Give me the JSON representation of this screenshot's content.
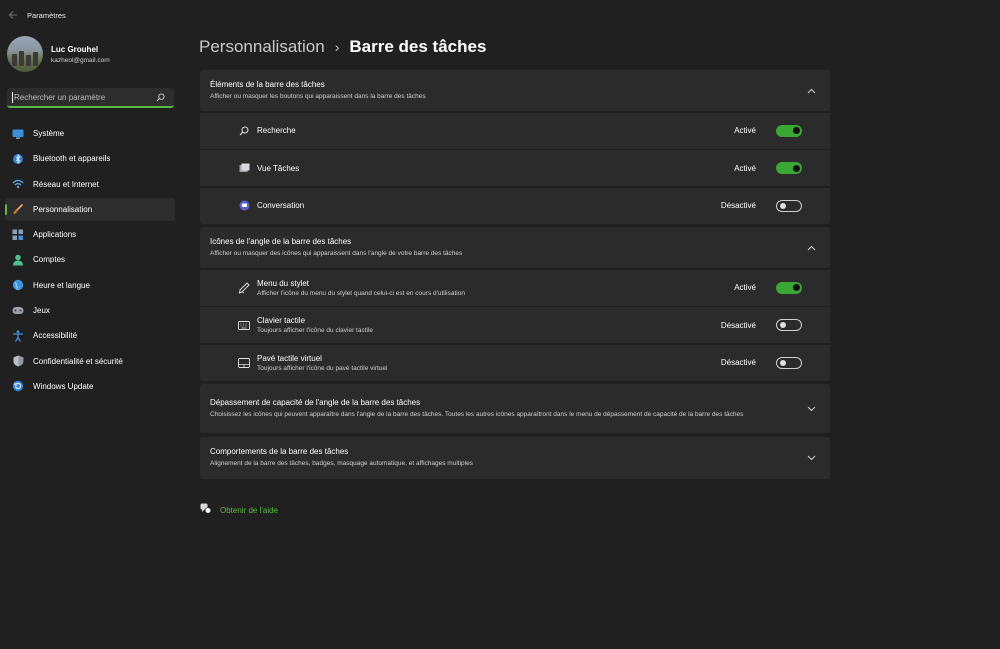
{
  "window": {
    "title": "Paramètres"
  },
  "profile": {
    "name": "Luc Grouhel",
    "email": "kazheol@gmail.com"
  },
  "search": {
    "placeholder": "Rechercher un paramètre"
  },
  "nav": [
    {
      "label": "Système",
      "icon": "system-icon",
      "active": false
    },
    {
      "label": "Bluetooth et appareils",
      "icon": "bluetooth-icon",
      "active": false
    },
    {
      "label": "Réseau et Internet",
      "icon": "wifi-icon",
      "active": false
    },
    {
      "label": "Personnalisation",
      "icon": "brush-icon",
      "active": true
    },
    {
      "label": "Applications",
      "icon": "apps-icon",
      "active": false
    },
    {
      "label": "Comptes",
      "icon": "account-icon",
      "active": false
    },
    {
      "label": "Heure et langue",
      "icon": "globe-icon",
      "active": false
    },
    {
      "label": "Jeux",
      "icon": "gamepad-icon",
      "active": false
    },
    {
      "label": "Accessibilité",
      "icon": "accessibility-icon",
      "active": false
    },
    {
      "label": "Confidentialité et sécurité",
      "icon": "shield-icon",
      "active": false
    },
    {
      "label": "Windows Update",
      "icon": "update-icon",
      "active": false
    }
  ],
  "breadcrumb": {
    "parent": "Personnalisation",
    "separator": "›",
    "current": "Barre des tâches"
  },
  "sections": {
    "taskbar_items": {
      "title": "Éléments de la barre des tâches",
      "desc": "Afficher ou masquer les boutons qui apparaissent dans la barre des tâches",
      "rows": [
        {
          "label": "Recherche",
          "state": "Activé",
          "on": true,
          "icon": "search-icon"
        },
        {
          "label": "Vue Tâches",
          "state": "Activé",
          "on": true,
          "icon": "task-view-icon"
        },
        {
          "label": "Conversation",
          "state": "Désactivé",
          "on": false,
          "icon": "chat-icon"
        }
      ]
    },
    "corner_icons": {
      "title": "Icônes de l'angle de la barre des tâches",
      "desc": "Afficher ou masquer des icônes qui apparaissent dans l'angle de votre barre des tâches",
      "rows": [
        {
          "label": "Menu du stylet",
          "sub": "Afficher l'icône du menu du stylet quand celui-ci est en cours d'utilisation",
          "state": "Activé",
          "on": true,
          "icon": "pen-icon"
        },
        {
          "label": "Clavier tactile",
          "sub": "Toujours afficher l'icône du clavier tactile",
          "state": "Désactivé",
          "on": false,
          "icon": "keyboard-icon"
        },
        {
          "label": "Pavé tactile virtuel",
          "sub": "Toujours afficher l'icône du pavé tactile virtuel",
          "state": "Désactivé",
          "on": false,
          "icon": "touchpad-icon"
        }
      ]
    },
    "overflow": {
      "title": "Dépassement de capacité de l'angle de la barre des tâches",
      "desc": "Choisissez les icônes qui peuvent apparaître dans l'angle de la barre des tâches. Toutes les autres icônes apparaîtront dans le menu de dépassement de capacité de la barre des tâches"
    },
    "behaviors": {
      "title": "Comportements de la barre des tâches",
      "desc": "Alignement de la barre des tâches, badges, masquage automatique, et affichages multiples"
    }
  },
  "help": {
    "label": "Obtenir de l'aide"
  },
  "colors": {
    "accent": "#5fb845",
    "toggle_on": "#3aa634",
    "background": "#202020",
    "card": "#2b2b2b"
  }
}
